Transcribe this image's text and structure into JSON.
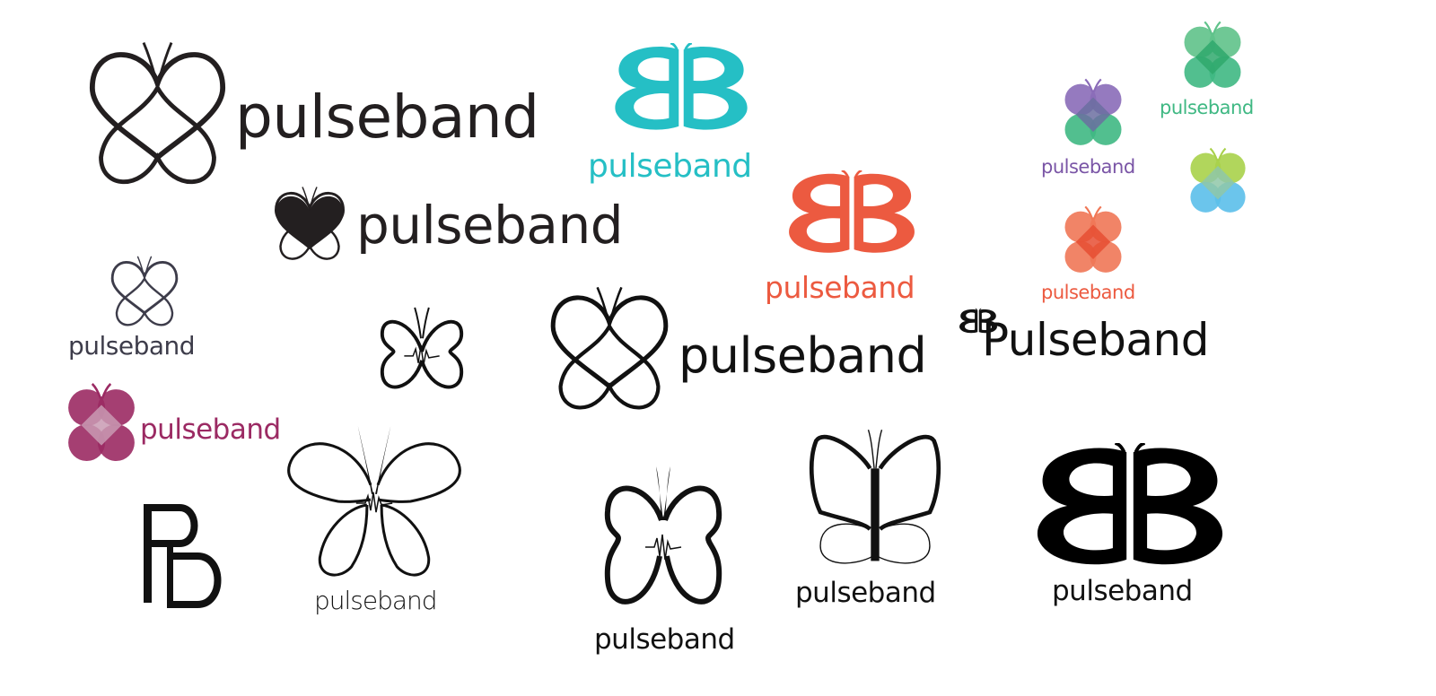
{
  "colors": {
    "black": "#231f20",
    "teal": "#25bfc5",
    "coral": "#ec5a40",
    "purple": "#7a55a6",
    "green": "#3fb883",
    "lime": "#a8d14a",
    "sky": "#5bbfea",
    "salmon": "#f07756",
    "magenta": "#9b2a63",
    "slate": "#3d3c4a"
  },
  "logos": [
    {
      "id": "a",
      "wordmark": "pulseband",
      "icon": "butterfly-heart-outline-icon"
    },
    {
      "id": "b",
      "wordmark": "pulseband",
      "icon": "double-b-butterfly-icon"
    },
    {
      "id": "c",
      "wordmark": "pulseband",
      "icon": "butterfly-heart-overlap-icon"
    },
    {
      "id": "d",
      "wordmark": "pulseband",
      "icon": "butterfly-heart-overlap-icon"
    },
    {
      "id": "e",
      "wordmark": "pulseband",
      "icon": "butterfly-heart-filled-icon"
    },
    {
      "id": "f",
      "wordmark": "pulseband",
      "icon": "double-b-butterfly-icon"
    },
    {
      "id": "g",
      "wordmark": "pulseband",
      "icon": "butterfly-heart-overlap-icon"
    },
    {
      "id": "h",
      "wordmark": "pulseband",
      "icon": "butterfly-heart-outline-icon"
    },
    {
      "id": "i",
      "wordmark": "pulseband",
      "icon": "butterfly-heart-outline-icon"
    },
    {
      "id": "j",
      "wordmark": "Pulseband",
      "icon": "small-butterfly-icon"
    },
    {
      "id": "k",
      "wordmark": "pulseband",
      "icon": "butterfly-heart-overlap-icon"
    },
    {
      "id": "l",
      "wordmark": "pulseband",
      "icon": "butterfly-pulse-icon"
    },
    {
      "id": "m",
      "wordmark": "pulseband",
      "icon": "butterfly-pulse-icon"
    },
    {
      "id": "n",
      "wordmark": "pulseband",
      "icon": "butterfly-y-icon"
    },
    {
      "id": "o",
      "wordmark": "pulseband",
      "icon": "double-b-butterfly-icon"
    }
  ],
  "icons": {
    "heart_butterfly_plain": "butterfly-heart-overlap-icon",
    "pulse_butterfly": "butterfly-pulse-icon",
    "pb_monogram": "pb-monogram-icon"
  }
}
